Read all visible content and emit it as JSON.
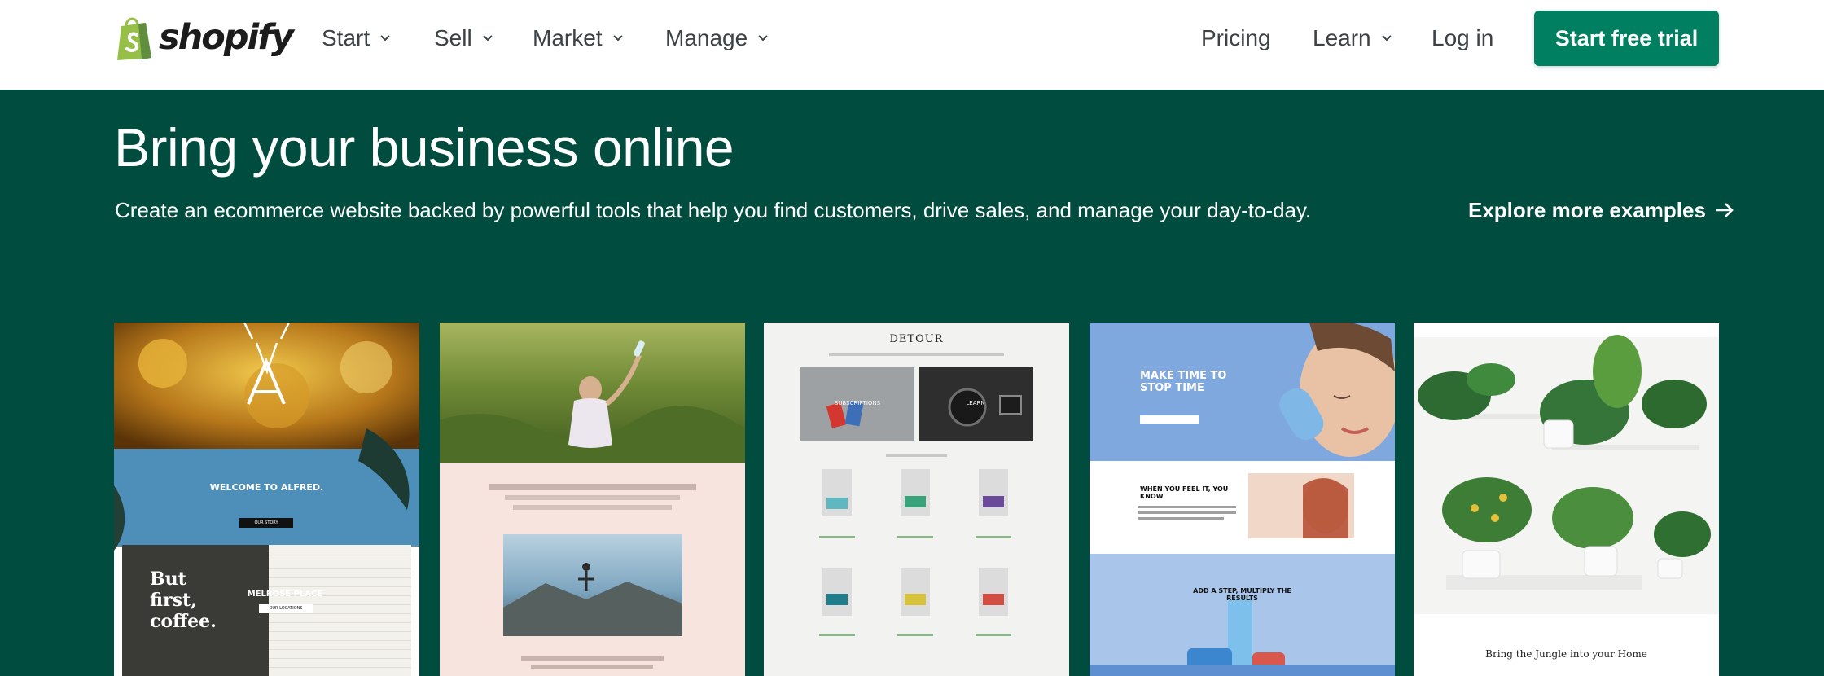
{
  "brand": {
    "name": "shopify"
  },
  "nav": {
    "items": [
      "Start",
      "Sell",
      "Market",
      "Manage"
    ],
    "pricing": "Pricing",
    "learn": "Learn",
    "login": "Log in",
    "cta": "Start free trial"
  },
  "hero": {
    "title": "Bring your business online",
    "subtitle": "Create an ecommerce website backed by powerful tools that help you find customers, drive sales, and manage your day-to-day.",
    "explore_link": "Explore more examples"
  },
  "examples": [
    {
      "name": "Alfred",
      "texts": [
        "WELCOME TO ALFRED.",
        "OUR STORY",
        "But first, coffee.",
        "MELROSE PLACE",
        "OUR LOCATIONS"
      ]
    },
    {
      "name": "yoga-store",
      "texts": []
    },
    {
      "name": "Detour",
      "texts": [
        "DETOUR",
        "SUBSCRIPTIONS",
        "LEARN"
      ]
    },
    {
      "name": "skincare",
      "texts": [
        "MAKE TIME TO STOP TIME",
        "WHEN YOU FEEL IT, YOU KNOW",
        "ADD A STEP, MULTIPLY THE RESULTS"
      ]
    },
    {
      "name": "plants",
      "texts": [
        "Bring the Jungle into your Home"
      ]
    }
  ],
  "colors": {
    "nav_bg": "#ffffff",
    "hero_bg": "#004c3f",
    "cta_bg": "#008060",
    "logo_green": "#95bf47"
  }
}
